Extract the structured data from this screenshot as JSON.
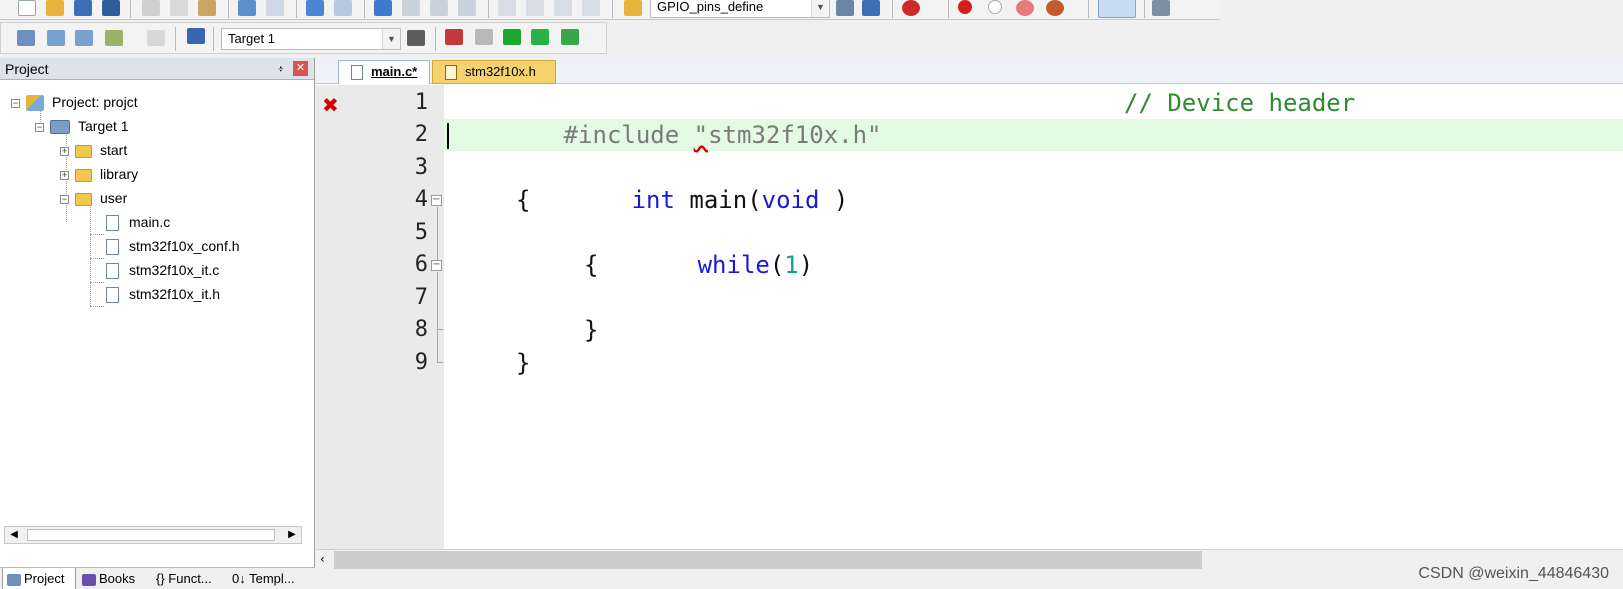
{
  "toolbar": {
    "function_combo": "GPIO_pins_define",
    "target_combo": "Target 1"
  },
  "project_panel": {
    "title": "Project",
    "pin_glyph": "፥",
    "close_glyph": "✕",
    "tree": {
      "project_label": "Project: projct",
      "target_label": "Target 1",
      "groups": [
        {
          "label": "start"
        },
        {
          "label": "library"
        },
        {
          "label": "user"
        }
      ],
      "user_files": [
        "main.c",
        "stm32f10x_conf.h",
        "stm32f10x_it.c",
        "stm32f10x_it.h"
      ]
    },
    "bottom_tabs": [
      "Project",
      "Books",
      "{} Funct...",
      "0↓ Templ..."
    ]
  },
  "editor": {
    "tabs": [
      {
        "label": "main.c*",
        "active": true
      },
      {
        "label": "stm32f10x.h",
        "active": false
      }
    ],
    "line_numbers": [
      "1",
      "2",
      "3",
      "4",
      "5",
      "6",
      "7",
      "8",
      "9"
    ],
    "lines": {
      "l1_directive": "#include",
      "l1_q": "\"",
      "l1_file": "stm32f10x.h\"",
      "l1_comment": "// Device header",
      "l3_type": "int",
      "l3_name": "main(",
      "l3_void": "void",
      "l3_close": " )",
      "l4": "{",
      "l5_kw": "while",
      "l5_open": "(",
      "l5_num": "1",
      "l5_close": ")",
      "l6": "{",
      "l8": "}",
      "l9": "}"
    },
    "error_marker": "✖"
  },
  "watermark": "CSDN @weixin_44846430",
  "colors": {
    "current_line": "#e3fbe3",
    "keyword": "#1a1ad6",
    "comment": "#2e8b2e",
    "active_tab_bg": "#ffffff",
    "inactive_tab_bg": "#f5d26d"
  }
}
